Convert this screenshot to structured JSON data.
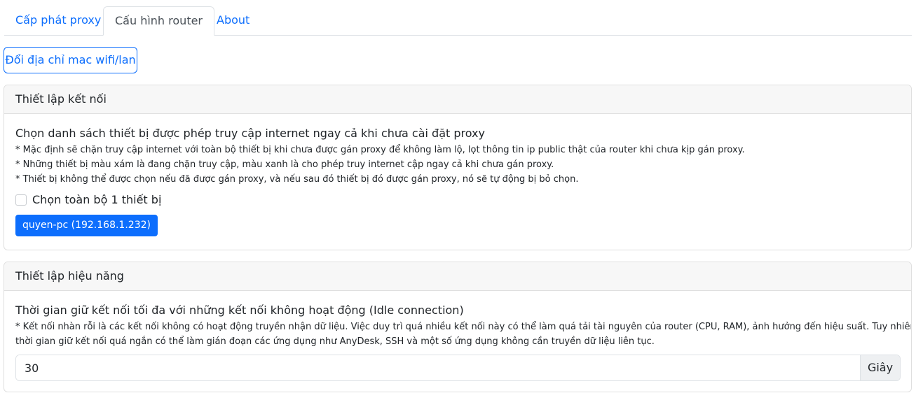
{
  "tabs": [
    {
      "label": "Cấp phát proxy",
      "active": false
    },
    {
      "label": "Cấu hình router",
      "active": true
    },
    {
      "label": "About",
      "active": false
    }
  ],
  "mac_button_label": "Đổi địa chỉ mac wifi/lan",
  "connection": {
    "header": "Thiết lập kết nối",
    "lead": "Chọn danh sách thiết bị được phép truy cập internet ngay cả khi chưa cài đặt proxy",
    "notes": [
      "* Mặc định sẽ chặn truy cập internet với toàn bộ thiết bị khi chưa được gán proxy để không làm lộ, lọt thông tin ip public thật của router khi chưa kịp gán proxy.",
      "* Những thiết bị màu xám là đang chặn truy cập, màu xanh là cho phép truy internet cập ngay cả khi chưa gán proxy.",
      "* Thiết bị không thể được chọn nếu đã được gán proxy, và nếu sau đó thiết bị đó được gán proxy, nó sẽ tự động bị bỏ chọn."
    ],
    "select_all_label": "Chọn toàn bộ 1 thiết bị",
    "select_all_checked": false,
    "devices": [
      {
        "label": "quyen-pc (192.168.1.232)",
        "allowed": true
      }
    ]
  },
  "performance": {
    "header": "Thiết lập hiệu năng",
    "lead": "Thời gian giữ kết nối tối đa với những kết nối không hoạt động (Idle connection)",
    "notes": [
      "* Kết nối nhàn rỗi là các kết nối không có hoạt động truyền nhận dữ liệu. Việc duy trì quá nhiều kết nối này có thể làm quá tải tài nguyên của router (CPU, RAM), ảnh hưởng đến hiệu suất. Tuy nhiên, đặt",
      "thời gian giữ kết nối quá ngắn có thể làm gián đoạn các ứng dụng như AnyDesk, SSH và một số ứng dụng không cần truyền dữ liệu liên tục."
    ],
    "idle_timeout_value": "30",
    "idle_timeout_unit": "Giây"
  },
  "colors": {
    "primary": "#0d6efd",
    "card_header_bg": "#f7f7f7",
    "border": "#dee2e6"
  }
}
